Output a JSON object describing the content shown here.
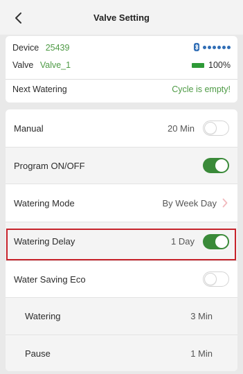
{
  "header": {
    "title": "Valve Setting"
  },
  "info": {
    "device_label": "Device",
    "device_id": "25439",
    "valve_label": "Valve",
    "valve_name": "Valve_1",
    "battery": "100%",
    "next_label": "Next Watering",
    "next_value": "Cycle is empty!"
  },
  "settings": {
    "manual_label": "Manual",
    "manual_value": "20 Min",
    "program_label": "Program ON/OFF",
    "mode_label": "Watering Mode",
    "mode_value": "By Week Day",
    "delay_label": "Watering Delay",
    "delay_value": "1 Day",
    "eco_label": "Water Saving Eco",
    "eco_watering_label": "Watering",
    "eco_watering_value": "3 Min",
    "eco_pause_label": "Pause",
    "eco_pause_value": "1 Min"
  },
  "toggles": {
    "manual": false,
    "program": true,
    "delay": true,
    "eco": false
  },
  "colors": {
    "accent_green": "#3a8a39",
    "text_green": "#4d9a44",
    "bluetooth_blue": "#2f6db5",
    "highlight_red": "#c7232b"
  },
  "icons": {
    "back": "chevron-left-icon",
    "bluetooth": "bluetooth-icon",
    "battery": "battery-icon",
    "mode_arrow": "chevron-right-icon"
  }
}
